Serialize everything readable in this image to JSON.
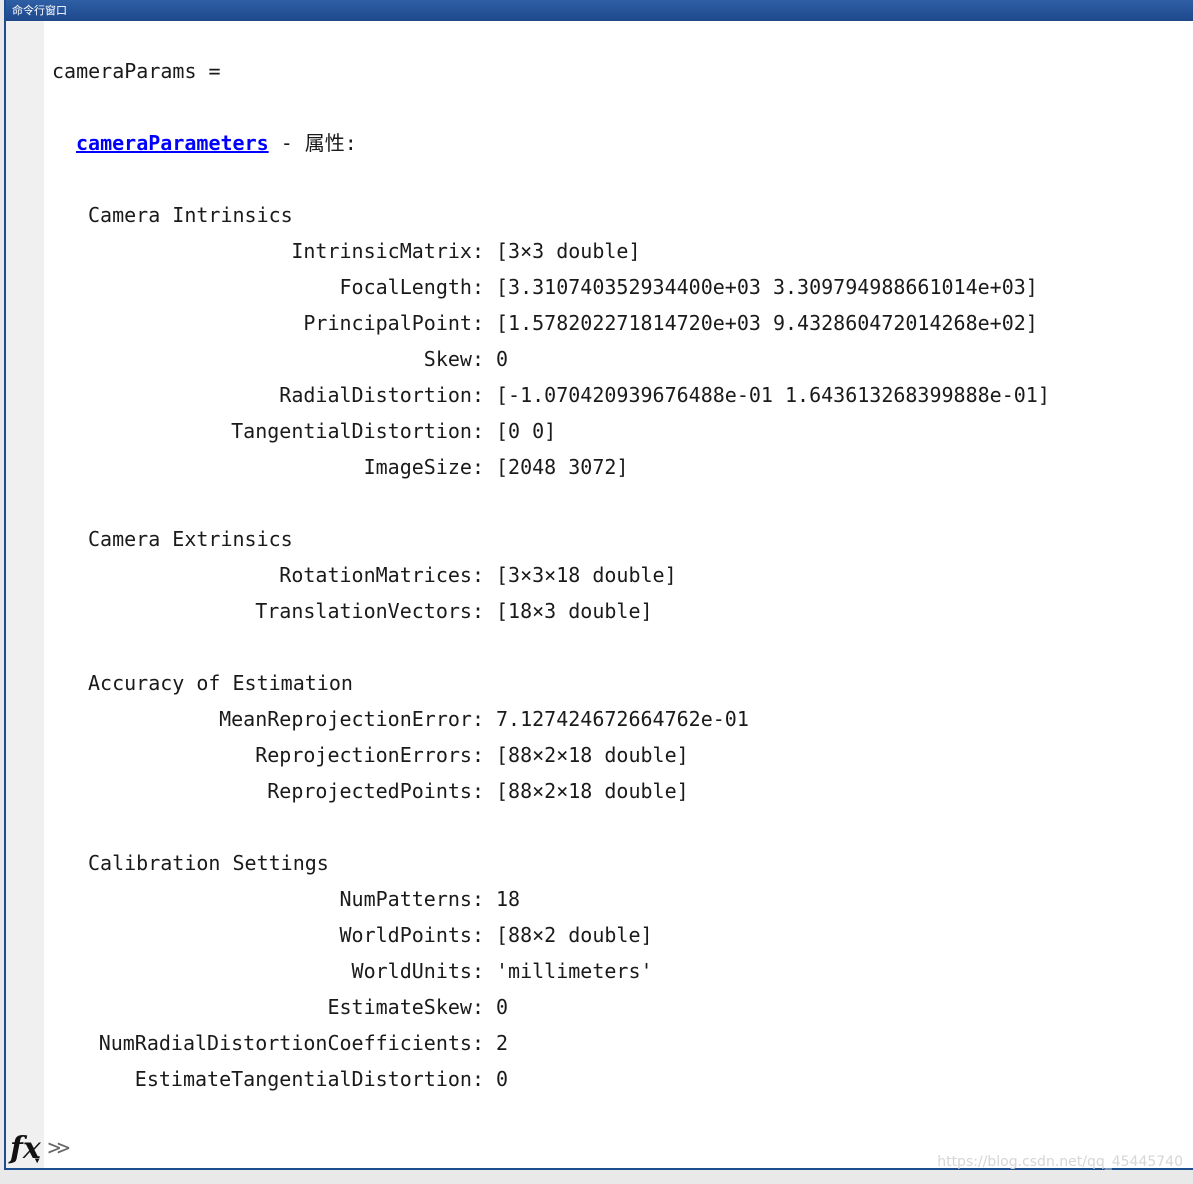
{
  "window": {
    "title": "命令行窗口"
  },
  "output": {
    "var_line": "cameraParams =",
    "class_link": "cameraParameters",
    "class_suffix": " - 属性:",
    "sections": [
      {
        "header": "Camera Intrinsics",
        "props": [
          {
            "key": "IntrinsicMatrix:",
            "value": "[3×3 double]"
          },
          {
            "key": "FocalLength:",
            "value": "[3.310740352934400e+03 3.309794988661014e+03]"
          },
          {
            "key": "PrincipalPoint:",
            "value": "[1.578202271814720e+03 9.432860472014268e+02]"
          },
          {
            "key": "Skew:",
            "value": "0"
          },
          {
            "key": "RadialDistortion:",
            "value": "[-1.070420939676488e-01 1.643613268399888e-01]"
          },
          {
            "key": "TangentialDistortion:",
            "value": "[0 0]"
          },
          {
            "key": "ImageSize:",
            "value": "[2048 3072]"
          }
        ]
      },
      {
        "header": "Camera Extrinsics",
        "props": [
          {
            "key": "RotationMatrices:",
            "value": "[3×3×18 double]"
          },
          {
            "key": "TranslationVectors:",
            "value": "[18×3 double]"
          }
        ]
      },
      {
        "header": "Accuracy of Estimation",
        "props": [
          {
            "key": "MeanReprojectionError:",
            "value": "7.127424672664762e-01"
          },
          {
            "key": "ReprojectionErrors:",
            "value": "[88×2×18 double]"
          },
          {
            "key": "ReprojectedPoints:",
            "value": "[88×2×18 double]"
          }
        ]
      },
      {
        "header": "Calibration Settings",
        "props": [
          {
            "key": "NumPatterns:",
            "value": "18"
          },
          {
            "key": "WorldPoints:",
            "value": "[88×2 double]"
          },
          {
            "key": "WorldUnits:",
            "value": "'millimeters'"
          },
          {
            "key": "EstimateSkew:",
            "value": "0"
          },
          {
            "key": "NumRadialDistortionCoefficients:",
            "value": "2"
          },
          {
            "key": "EstimateTangentialDistortion:",
            "value": "0"
          }
        ]
      }
    ]
  },
  "prompt": {
    "fx_icon": "fx",
    "chevrons": ">>"
  },
  "watermark": "https://blog.csdn.net/qq_45445740"
}
